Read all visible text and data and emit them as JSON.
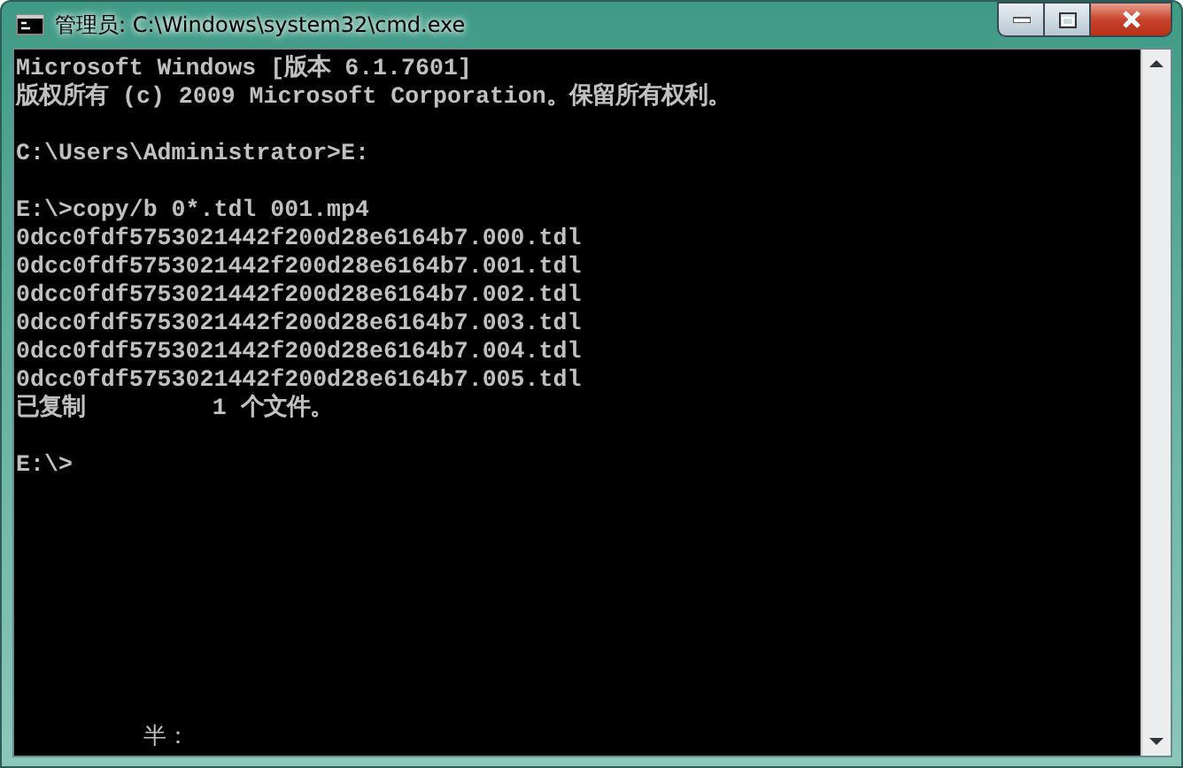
{
  "window": {
    "title": "管理员: C:\\Windows\\system32\\cmd.exe"
  },
  "console": {
    "blocks": [
      [
        "Microsoft Windows [版本 6.1.7601]",
        "版权所有 (c) 2009 Microsoft Corporation。保留所有权利。"
      ],
      [
        "C:\\Users\\Administrator>E:"
      ],
      [
        "E:\\>copy/b 0*.tdl 001.mp4",
        "0dcc0fdf5753021442f200d28e6164b7.000.tdl",
        "0dcc0fdf5753021442f200d28e6164b7.001.tdl",
        "0dcc0fdf5753021442f200d28e6164b7.002.tdl",
        "0dcc0fdf5753021442f200d28e6164b7.003.tdl",
        "0dcc0fdf5753021442f200d28e6164b7.004.tdl",
        "0dcc0fdf5753021442f200d28e6164b7.005.tdl",
        "已复制         1 个文件。"
      ],
      [
        "E:\\>"
      ]
    ],
    "ime_status": "半："
  }
}
